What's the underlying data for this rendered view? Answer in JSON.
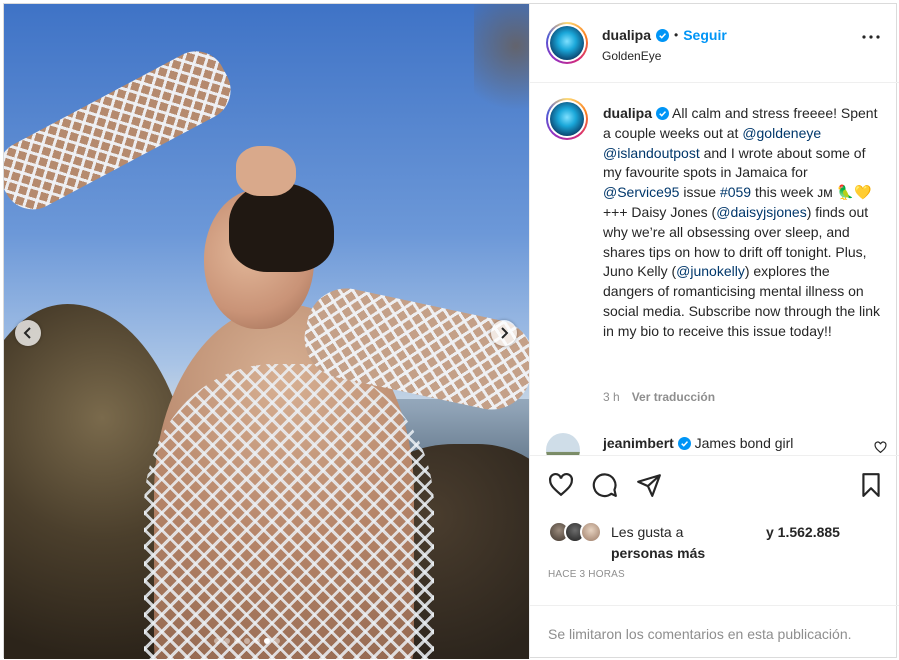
{
  "post": {
    "username": "dualipa",
    "follow_label": "Seguir",
    "separator": "•",
    "location": "GoldenEye",
    "colors": {
      "accent": "#0095f6",
      "mention": "#00376b",
      "muted": "#8e8e8e"
    },
    "carousel": {
      "slide_count": 7,
      "active_slide": 6
    }
  },
  "caption": {
    "username": "dualipa",
    "segments": [
      {
        "type": "text",
        "value": "All calm and stress freeee! Spent a couple weeks out at "
      },
      {
        "type": "mention",
        "value": "@goldeneye"
      },
      {
        "type": "text",
        "value": " "
      },
      {
        "type": "mention",
        "value": "@islandoutpost"
      },
      {
        "type": "text",
        "value": " and I wrote about some of my favourite spots in Jamaica for "
      },
      {
        "type": "mention",
        "value": "@Service95"
      },
      {
        "type": "text",
        "value": " issue "
      },
      {
        "type": "mention",
        "value": "#059"
      },
      {
        "type": "text",
        "value": " this week ᴊᴍ 🦜💛 +++ Daisy Jones ("
      },
      {
        "type": "mention",
        "value": "@daisyjsjones"
      },
      {
        "type": "text",
        "value": ") finds out why we’re all obsessing over sleep, and shares tips on how to drift off tonight. Plus, Juno Kelly ("
      },
      {
        "type": "mention",
        "value": "@junokelly"
      },
      {
        "type": "text",
        "value": ") explores the dangers of romanticising mental illness on social media. Subscribe now through the link in my bio to receive this issue today!!"
      }
    ],
    "time": "3 h",
    "translate_label": "Ver traducción"
  },
  "comment": {
    "username": "jeanimbert",
    "text": "James bond girl"
  },
  "likes": {
    "prefix": "Les gusta a",
    "count_text": "y 1.562.885",
    "suffix": "personas más"
  },
  "timestamp": "Hace 3 horas",
  "comments_limited": "Se limitaron los comentarios en esta publicación."
}
